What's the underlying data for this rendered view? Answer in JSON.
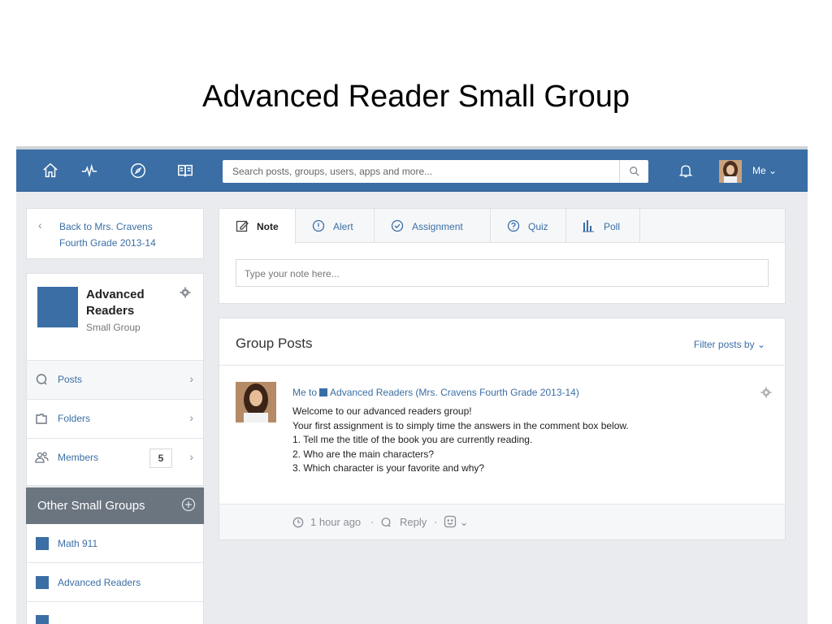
{
  "slide": {
    "title": "Advanced Reader Small Group"
  },
  "topnav": {
    "icons": [
      "home-icon",
      "activity-icon",
      "discover-icon",
      "catalog-icon"
    ],
    "search_placeholder": "Search posts, groups, users, apps and more...",
    "user_label": "Me",
    "accent": "#3a6ea5"
  },
  "sidebar": {
    "back_line1": "Back to Mrs. Cravens",
    "back_line2": "Fourth Grade 2013-14",
    "group_name_line1": "Advanced",
    "group_name_line2": "Readers",
    "group_type": "Small Group",
    "menu": [
      {
        "label": "Posts"
      },
      {
        "label": "Folders"
      },
      {
        "label": "Members",
        "count": "5"
      }
    ],
    "other_title": "Other Small Groups",
    "other_groups": [
      {
        "label": "Math 911"
      },
      {
        "label": "Advanced Readers"
      }
    ]
  },
  "composer": {
    "tabs": [
      {
        "label": "Note"
      },
      {
        "label": "Alert"
      },
      {
        "label": "Assignment"
      },
      {
        "label": "Quiz"
      },
      {
        "label": "Poll"
      }
    ],
    "placeholder": "Type your note here..."
  },
  "posts": {
    "title": "Group Posts",
    "filter_label": "Filter posts by",
    "post": {
      "author": "Me",
      "to": "to",
      "group": "Advanced Readers (Mrs. Cravens Fourth Grade 2013-14)",
      "lines": [
        "Welcome to our advanced readers group!",
        "Your first assignment is to simply time the answers in the comment box below.",
        "1. Tell me the title of the book you are currently reading.",
        "2. Who are the main characters?",
        "3. Which character is your favorite and why?"
      ],
      "time": "1 hour ago",
      "reply": "Reply",
      "sep": "·"
    }
  }
}
